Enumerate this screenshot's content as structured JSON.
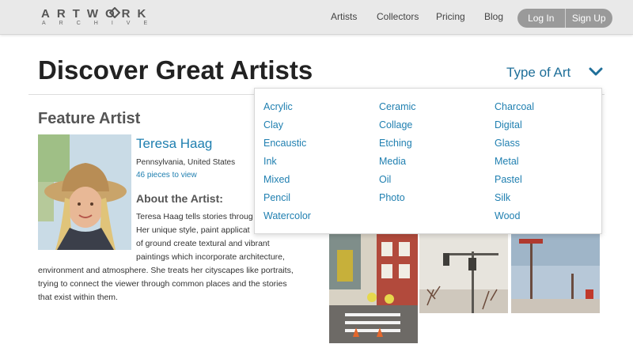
{
  "header": {
    "logo_top": "ARTWORK",
    "logo_bottom": "ARCHIVE",
    "nav": [
      "Artists",
      "Collectors",
      "Pricing",
      "Blog"
    ],
    "login_label": "Log In",
    "signup_label": "Sign Up"
  },
  "hero": {
    "title": "Discover Great Artists",
    "filter_label": "Type of Art"
  },
  "feature": {
    "section_title": "Feature Artist",
    "name": "Teresa Haag",
    "location": "Pennsylvania, United States",
    "pieces_link": "46 pieces to view",
    "about_heading": "About the Artist:",
    "bio_lines": [
      "Teresa Haag tells stories throug",
      "Her unique style, paint applicat",
      "of ground create textural and vibrant",
      "paintings which incorporate architecture,",
      "environment and atmosphere. She treats her cityscapes like portraits,",
      "trying to connect the viewer through common places and the stories",
      "that exist within them."
    ]
  },
  "dropdown": {
    "columns": [
      [
        "Acrylic",
        "Clay",
        "Encaustic",
        "Ink",
        "Mixed",
        "Pencil",
        "Watercolor"
      ],
      [
        "Ceramic",
        "Collage",
        "Etching",
        "Media",
        "Oil",
        "Photo"
      ],
      [
        "Charcoal",
        "Digital",
        "Glass",
        "Metal",
        "Pastel",
        "Silk",
        "Wood"
      ]
    ]
  },
  "colors": {
    "link": "#1f7fb0",
    "header_bg": "#e9e9e9",
    "auth_bg": "#9a9a9a"
  }
}
